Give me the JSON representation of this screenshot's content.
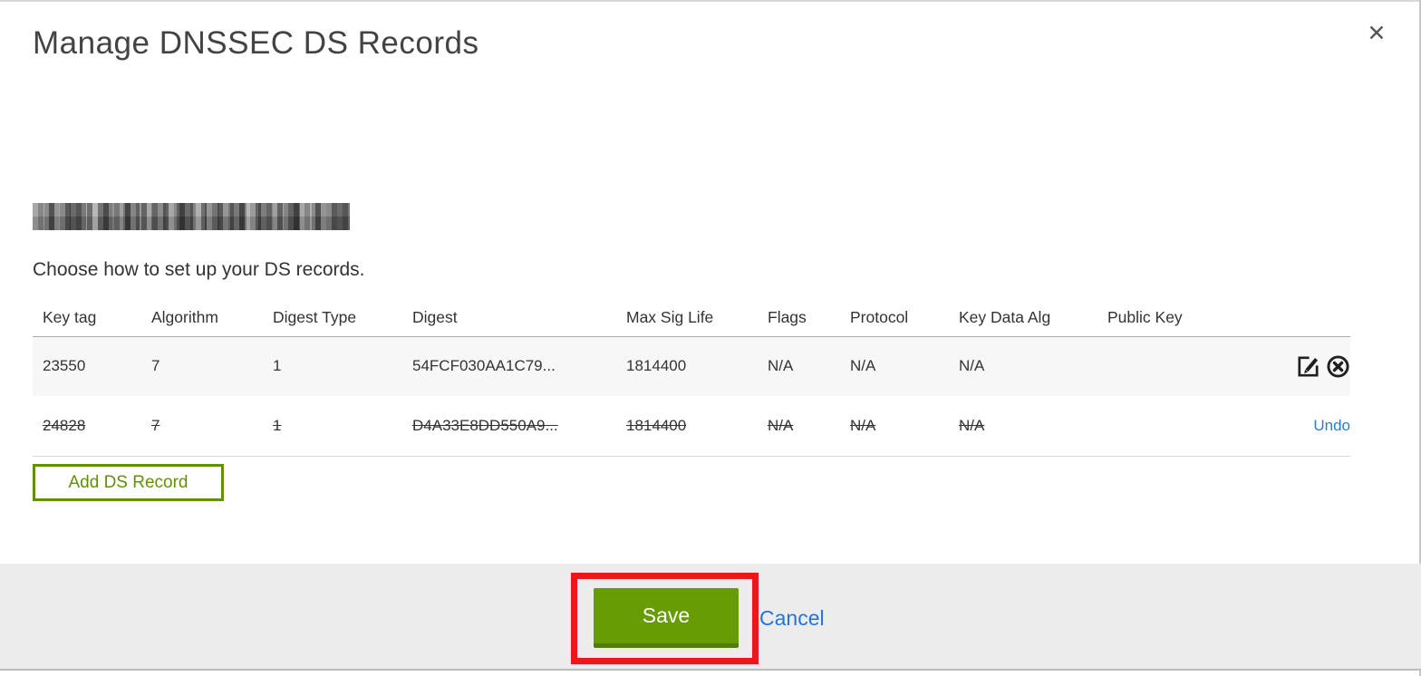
{
  "modal": {
    "title": "Manage DNSSEC DS Records",
    "subtitle": "Choose how to set up your DS records.",
    "domain": {
      "redacted": true
    }
  },
  "icons": {
    "close": "✕",
    "edit": "edit-in-square",
    "delete": "circle-x"
  },
  "table": {
    "columns": [
      "Key tag",
      "Algorithm",
      "Digest Type",
      "Digest",
      "Max Sig Life",
      "Flags",
      "Protocol",
      "Key Data Alg",
      "Public Key"
    ],
    "rows": [
      {
        "cells": [
          "23550",
          "7",
          "1",
          "54FCF030AA1C79...",
          "1814400",
          "N/A",
          "N/A",
          "N/A",
          ""
        ],
        "deleted": false
      },
      {
        "cells": [
          "24828",
          "7",
          "1",
          "D4A33E8DD550A9...",
          "1814400",
          "N/A",
          "N/A",
          "N/A",
          ""
        ],
        "deleted": true,
        "undo_label": "Undo"
      }
    ]
  },
  "buttons": {
    "add_ds_record": "Add DS Record",
    "save": "Save",
    "cancel": "Cancel"
  },
  "colors": {
    "accent_green": "#689c03",
    "outline_button_green": "#61900a",
    "link_blue": "#2673dc",
    "annotation_red": "#ee1616",
    "row_stripe_gray": "#f7f7f7",
    "footer_gray": "#ececec"
  }
}
